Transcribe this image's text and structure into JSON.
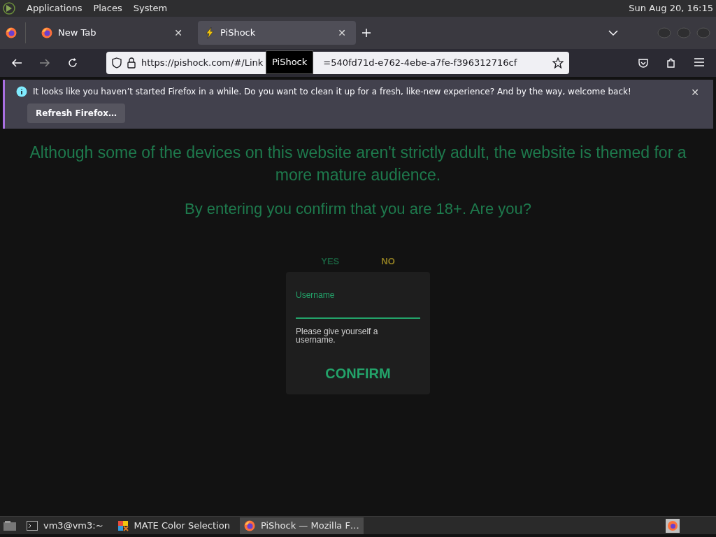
{
  "top_panel": {
    "menus": [
      "Applications",
      "Places",
      "System"
    ],
    "clock": "Sun Aug 20, 16:15"
  },
  "tabs": [
    {
      "label": "New Tab",
      "close": "✕",
      "selected": false
    },
    {
      "label": "PiShock",
      "close": "✕",
      "selected": true
    }
  ],
  "tooltip": "PiShock",
  "address_bar": {
    "url_start": "https://pishock.com/#/Link",
    "url_end": "=540fd71d-e762-4ebe-a7fe-f396312716cf"
  },
  "notification": {
    "message": "It looks like you haven’t started Firefox in a while. Do you want to clean it up for a fresh, like-new experience? And by the way, welcome back!",
    "button": "Refresh Firefox…",
    "close": "✕"
  },
  "page": {
    "notice": "Although some of the devices on this website aren't strictly adult, the website is themed for a more mature audience.",
    "question": "By entering you confirm that you are 18+. Are you?",
    "choices": [
      {
        "label": "YES",
        "kind": "yes"
      },
      {
        "label": "NO",
        "kind": "no"
      }
    ],
    "form": {
      "label": "Username",
      "hint": "Please give yourself a username.",
      "button": "CONFIRM"
    }
  },
  "taskbar": [
    {
      "label": "vm3@vm3:~",
      "selected": false
    },
    {
      "label": "MATE Color Selection",
      "selected": false
    },
    {
      "label": "PiShock — Mozilla F…",
      "selected": true
    }
  ]
}
